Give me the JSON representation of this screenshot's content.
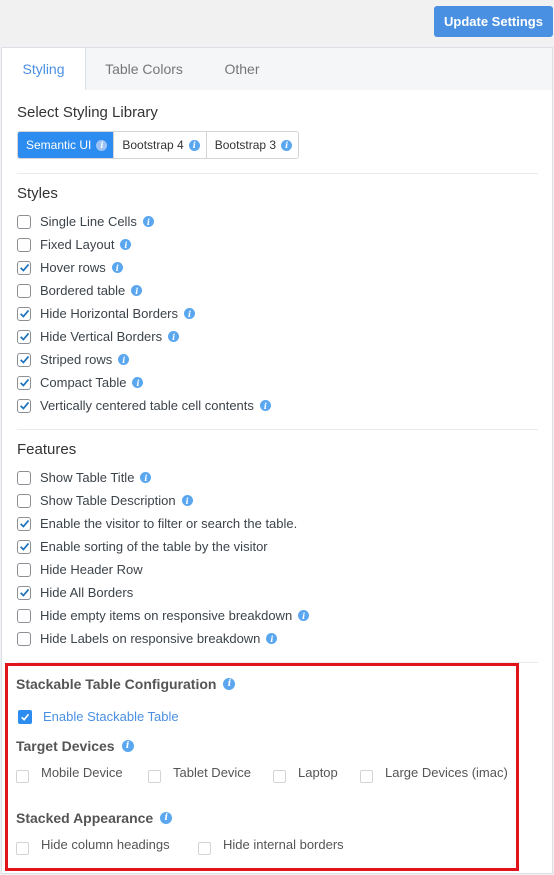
{
  "header": {
    "update_button": "Update Settings"
  },
  "tabs": [
    {
      "label": "Styling",
      "active": true
    },
    {
      "label": "Table Colors",
      "active": false
    },
    {
      "label": "Other",
      "active": false
    }
  ],
  "styling_library": {
    "title": "Select Styling Library",
    "options": [
      {
        "label": "Semantic UI",
        "selected": true
      },
      {
        "label": "Bootstrap 4",
        "selected": false
      },
      {
        "label": "Bootstrap 3",
        "selected": false
      }
    ]
  },
  "styles": {
    "title": "Styles",
    "items": [
      {
        "label": "Single Line Cells",
        "checked": false,
        "info": true
      },
      {
        "label": "Fixed Layout",
        "checked": false,
        "info": true
      },
      {
        "label": "Hover rows",
        "checked": true,
        "info": true
      },
      {
        "label": "Bordered table",
        "checked": false,
        "info": true
      },
      {
        "label": "Hide Horizontal Borders",
        "checked": true,
        "info": true
      },
      {
        "label": "Hide Vertical Borders",
        "checked": true,
        "info": true
      },
      {
        "label": "Striped rows",
        "checked": true,
        "info": true
      },
      {
        "label": "Compact Table",
        "checked": true,
        "info": true
      },
      {
        "label": "Vertically centered table cell contents",
        "checked": true,
        "info": true
      }
    ]
  },
  "features": {
    "title": "Features",
    "items": [
      {
        "label": "Show Table Title",
        "checked": false,
        "info": true
      },
      {
        "label": "Show Table Description",
        "checked": false,
        "info": true
      },
      {
        "label": "Enable the visitor to filter or search the table.",
        "checked": true,
        "info": false
      },
      {
        "label": "Enable sorting of the table by the visitor",
        "checked": true,
        "info": false
      },
      {
        "label": "Hide Header Row",
        "checked": false,
        "info": false
      },
      {
        "label": "Hide All Borders",
        "checked": true,
        "info": false
      },
      {
        "label": "Hide empty items on responsive breakdown",
        "checked": false,
        "info": true
      },
      {
        "label": "Hide Labels on responsive breakdown",
        "checked": false,
        "info": true
      }
    ]
  },
  "stackable": {
    "title": "Stackable Table Configuration",
    "enable_label": "Enable Stackable Table",
    "enabled": true,
    "target_devices_title": "Target Devices",
    "devices": [
      {
        "label": "Mobile Device",
        "checked": false
      },
      {
        "label": "Tablet Device",
        "checked": false
      },
      {
        "label": "Laptop",
        "checked": false
      },
      {
        "label": "Large Devices (imac)",
        "checked": false
      }
    ],
    "appearance_title": "Stacked Appearance",
    "appearance": [
      {
        "label": "Hide column headings",
        "checked": false
      },
      {
        "label": "Hide internal borders",
        "checked": false
      }
    ]
  },
  "colors": {
    "accent": "#4a90e2",
    "selected": "#2d8cf0",
    "highlight": "#e0141a",
    "info": "#5aa7f0"
  }
}
